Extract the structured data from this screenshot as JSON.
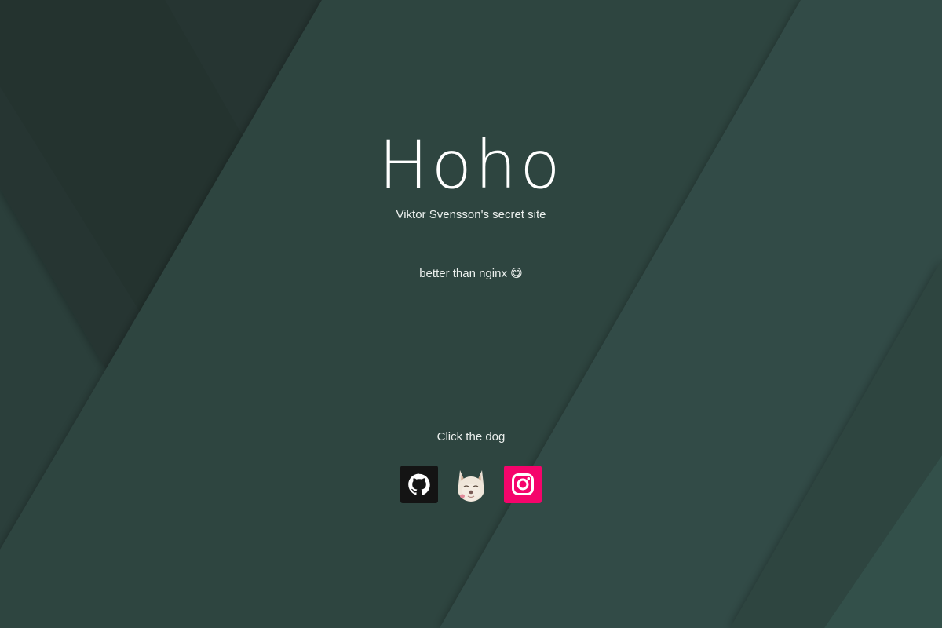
{
  "page": {
    "title": "Hoho",
    "subtitle": "Viktor Svensson's secret site",
    "tagline": "better than nginx 😋",
    "cta": "Click the dog"
  },
  "links": [
    {
      "icon": "github-icon",
      "color": "#141414"
    },
    {
      "icon": "dog-icon"
    },
    {
      "icon": "instagram-icon",
      "color": "#f5046b"
    }
  ],
  "colors": {
    "background": "#2f4541",
    "text": "#ffffff"
  }
}
